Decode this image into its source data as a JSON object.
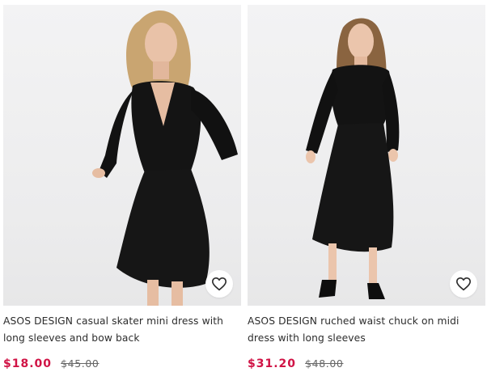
{
  "products": [
    {
      "title": "ASOS DESIGN casual skater mini dress with long sleeves and bow back",
      "price": "$18.00",
      "was_price": "$45.00",
      "save_icon": "heart-icon"
    },
    {
      "title": "ASOS DESIGN ruched waist chuck on midi dress with long sleeves",
      "price": "$31.20",
      "was_price": "$48.00",
      "save_icon": "heart-icon"
    }
  ],
  "colors": {
    "sale_price": "#d01345",
    "text": "#2d2d2d",
    "image_background": "#efeff0"
  }
}
